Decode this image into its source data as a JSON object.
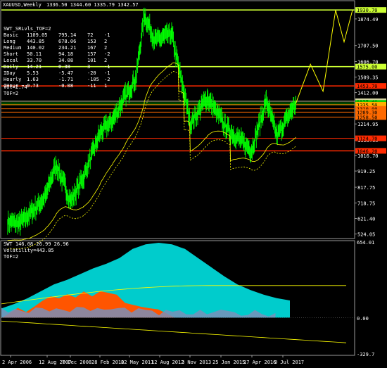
{
  "header": {
    "symbol": "XAUUSD,Weekly",
    "ohlc": "1336.50 1344.60 1335.79 1342.57"
  },
  "levels_table": {
    "title": "SWT_SRLvls_TOF=2",
    "rows": [
      {
        "name": "Basic",
        "a": "1109.05",
        "b": "795.14",
        "c": "72",
        "d": "-1"
      },
      {
        "name": "Long",
        "a": "443.85",
        "b": "678.06",
        "c": "153",
        "d": "2"
      },
      {
        "name": "Medium",
        "a": "140.02",
        "b": "234.21",
        "c": "167",
        "d": "2"
      },
      {
        "name": "Short",
        "a": "50.11",
        "b": "94.18",
        "c": "157",
        "d": "-2"
      },
      {
        "name": "Local",
        "a": "33.70",
        "b": "34.08",
        "c": "101",
        "d": "2"
      },
      {
        "name": "Daily",
        "a": "14.21",
        "b": "0.38",
        "c": "3",
        "d": "-1"
      },
      {
        "name": "IDay",
        "a": "5.53",
        "b": "-5.47",
        "c": "-20",
        "d": "-1"
      },
      {
        "name": "Hourly",
        "a": "1.63",
        "b": "-1.71",
        "c": "-105",
        "d": "-2"
      },
      {
        "name": "IHour",
        "a": "0.73",
        "b": "-0.08",
        "c": "-11",
        "d": "1"
      }
    ],
    "extra": [
      "Vol=2.74",
      "TOF=2"
    ]
  },
  "price_axis": [
    "1930.70",
    "1874.49",
    "1707.50",
    "1606.70",
    "1575.00",
    "1509.35",
    "1453.70",
    "1412.00",
    "1357.40",
    "1346.72",
    "1335.50",
    "1310.00",
    "1289.30",
    "1258.50",
    "1214.95",
    "1124.70",
    "1113.65",
    "1046.20",
    "1016.70",
    "919.25",
    "817.75",
    "718.75",
    "621.40",
    "524.05"
  ],
  "price_levels": [
    {
      "label": "1930.70",
      "price": 1930.7,
      "color": "#ccff33",
      "bg": "#ccff33"
    },
    {
      "label": "1575.00",
      "price": 1575.0,
      "color": "#ccff33",
      "bg": "#ccff33"
    },
    {
      "label": "1453.70",
      "price": 1453.7,
      "color": "#ff2a00",
      "bg": "#ff2a00"
    },
    {
      "label": "1357.40",
      "price": 1357.4,
      "color": "#d4d4a0",
      "bg": "#d4d4a0"
    },
    {
      "label": "1346.72",
      "price": 1346.72,
      "color": "#00d000",
      "bg": "#00d000"
    },
    {
      "label": "1335.50",
      "price": 1335.5,
      "color": "#ffb000",
      "bg": "#ffb000"
    },
    {
      "label": "1310.00",
      "price": 1310.0,
      "color": "#ff6a00",
      "bg": "#ff6a00"
    },
    {
      "label": "1289.30",
      "price": 1289.3,
      "color": "#ff6a00",
      "bg": "#ff6a00"
    },
    {
      "label": "1258.50",
      "price": 1258.5,
      "color": "#ff6a00",
      "bg": "#ff6a00"
    },
    {
      "label": "1124.70",
      "price": 1124.7,
      "color": "#ff2a00",
      "bg": "#ff2a00"
    },
    {
      "label": "1046.20",
      "price": 1046.2,
      "color": "#ff2a00",
      "bg": "#ff2a00"
    }
  ],
  "indicator": {
    "title": "SWT 146.08 26.99 26.96",
    "volatility": "Volatility=443.85",
    "tof": "TOF=2",
    "axis": [
      "654.01",
      "0.00",
      "-329.7"
    ]
  },
  "x_axis": [
    "2 Apr 2006",
    "12 Aug 2007",
    "7 Dec 2008",
    "28 Feb 2010",
    "22 May 2011",
    "12 Aug 2012",
    "3 Nov 2013",
    "25 Jan 2015",
    "17 Apr 2016",
    "9 Jul 2017"
  ],
  "chart_data": {
    "type": "line",
    "title": "XAUUSD,Weekly",
    "xlabel": "",
    "ylabel": "",
    "x_dates": [
      "2006-04-02",
      "2007-08-12",
      "2008-12-07",
      "2010-02-28",
      "2011-05-22",
      "2012-08-12",
      "2013-11-03",
      "2015-01-25",
      "2016-04-17",
      "2017-07-09"
    ],
    "price_series": [
      {
        "date": "2006-04",
        "close": 600
      },
      {
        "date": "2006-10",
        "close": 590
      },
      {
        "date": "2007-04",
        "close": 670
      },
      {
        "date": "2007-10",
        "close": 760
      },
      {
        "date": "2008-03",
        "close": 960
      },
      {
        "date": "2008-10",
        "close": 730
      },
      {
        "date": "2009-04",
        "close": 880
      },
      {
        "date": "2009-12",
        "close": 1160
      },
      {
        "date": "2010-06",
        "close": 1240
      },
      {
        "date": "2010-12",
        "close": 1390
      },
      {
        "date": "2011-05",
        "close": 1500
      },
      {
        "date": "2011-09",
        "close": 1900
      },
      {
        "date": "2012-02",
        "close": 1740
      },
      {
        "date": "2012-10",
        "close": 1780
      },
      {
        "date": "2013-04",
        "close": 1400
      },
      {
        "date": "2013-07",
        "close": 1220
      },
      {
        "date": "2014-03",
        "close": 1380
      },
      {
        "date": "2014-12",
        "close": 1190
      },
      {
        "date": "2015-12",
        "close": 1050
      },
      {
        "date": "2016-07",
        "close": 1360
      },
      {
        "date": "2016-12",
        "close": 1140
      },
      {
        "date": "2017-07",
        "close": 1300
      },
      {
        "date": "2017-09",
        "close": 1342.57
      }
    ],
    "projection": [
      {
        "date": "2017-09",
        "value": 1342.57
      },
      {
        "date": "2018-04",
        "value": 1590
      },
      {
        "date": "2018-10",
        "value": 1420
      },
      {
        "date": "2019-04",
        "value": 1930.7
      },
      {
        "date": "2019-08",
        "value": 1730
      },
      {
        "date": "2019-12",
        "value": 1930.7
      }
    ],
    "ylim": [
      500,
      1980
    ],
    "indicator_ylim": [
      -329.7,
      654.01
    ],
    "grid": false,
    "colors": {
      "price": "#00ff00",
      "band": "#ffff00",
      "cyan": "#00cccc",
      "orange": "#ff5500",
      "steel": "#7a8fb8"
    }
  }
}
